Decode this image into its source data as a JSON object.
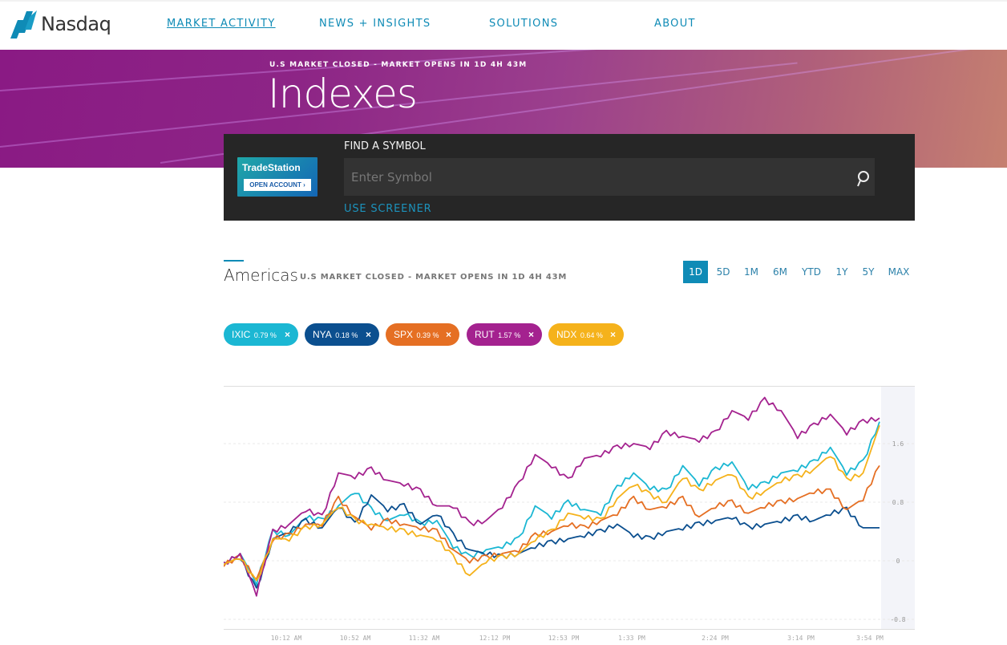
{
  "nav": {
    "logo_text": "Nasdaq",
    "items": [
      {
        "label": "MARKET ACTIVITY",
        "active": true
      },
      {
        "label": "NEWS + INSIGHTS"
      },
      {
        "label": "SOLUTIONS"
      },
      {
        "label": "ABOUT"
      }
    ]
  },
  "hero": {
    "status": "U.S MARKET CLOSED - MARKET OPENS IN 1D 4H 43M",
    "title": "Indexes"
  },
  "find": {
    "ad_brand": "TradeStation",
    "ad_button": "OPEN ACCOUNT ›",
    "label": "FIND A SYMBOL",
    "placeholder": "Enter Symbol",
    "screener": "USE SCREENER",
    "search_icon": "search-icon"
  },
  "region": {
    "title": "Americas",
    "status": "U.S MARKET CLOSED - MARKET OPENS IN 1D 4H 43M"
  },
  "timeframes": [
    "1D",
    "5D",
    "1M",
    "6M",
    "YTD",
    "1Y",
    "5Y",
    "MAX"
  ],
  "active_timeframe": "1D",
  "chips": [
    {
      "symbol": "IXIC",
      "pct": "0.79 %",
      "color": "#1bb7d3"
    },
    {
      "symbol": "NYA",
      "pct": "0.18 %",
      "color": "#0b4f8f"
    },
    {
      "symbol": "SPX",
      "pct": "0.39 %",
      "color": "#e56f23"
    },
    {
      "symbol": "RUT",
      "pct": "1.57 %",
      "color": "#a4228f"
    },
    {
      "symbol": "NDX",
      "pct": "0.64 %",
      "color": "#f5b21b"
    }
  ],
  "chart_data": {
    "type": "line",
    "title": "",
    "xlabel": "",
    "ylabel": "",
    "ylim": [
      -0.8,
      2.4
    ],
    "yticks": [
      "1.6",
      "0.8",
      "0",
      "-0.8"
    ],
    "ytick_values": [
      1.6,
      0.8,
      0,
      -0.8
    ],
    "xtick_labels": [
      "10:12 AM",
      "10:52 AM",
      "11:32 AM",
      "12:12 PM",
      "12:53 PM",
      "1:33 PM",
      "2:24 PM",
      "3:14 PM",
      "3:54 PM"
    ],
    "grid": true,
    "series": [
      {
        "name": "IXIC",
        "color": "#1bb7d3",
        "values": [
          -0.05,
          0.1,
          -0.3,
          0.4,
          0.35,
          0.6,
          0.55,
          0.75,
          0.95,
          0.7,
          0.55,
          0.65,
          0.5,
          0.55,
          0.2,
          0.05,
          0.15,
          0.2,
          0.3,
          0.75,
          0.6,
          0.8,
          0.7,
          0.65,
          1.0,
          1.2,
          1.0,
          0.95,
          1.3,
          1.05,
          1.25,
          1.35,
          1.0,
          1.05,
          1.2,
          1.25,
          1.35,
          1.55,
          1.2,
          1.35,
          1.9
        ]
      },
      {
        "name": "NYA",
        "color": "#0b4f8f",
        "values": [
          -0.05,
          0.05,
          -0.4,
          0.3,
          0.4,
          0.55,
          0.45,
          0.75,
          0.5,
          0.9,
          0.7,
          0.75,
          0.5,
          0.65,
          0.35,
          0.15,
          0.1,
          0.05,
          0.1,
          0.2,
          0.25,
          0.3,
          0.35,
          0.4,
          0.5,
          0.35,
          0.3,
          0.4,
          0.45,
          0.5,
          0.55,
          0.6,
          0.45,
          0.5,
          0.55,
          0.6,
          0.55,
          0.65,
          0.7,
          0.45,
          0.45
        ]
      },
      {
        "name": "SPX",
        "color": "#e56f23",
        "values": [
          -0.05,
          0.05,
          -0.25,
          0.3,
          0.35,
          0.5,
          0.5,
          0.85,
          0.6,
          0.45,
          0.55,
          0.5,
          0.45,
          0.4,
          0.15,
          0.0,
          0.05,
          0.1,
          0.15,
          0.35,
          0.4,
          0.5,
          0.45,
          0.55,
          0.65,
          0.85,
          0.7,
          0.75,
          0.85,
          0.6,
          0.75,
          0.8,
          0.65,
          0.75,
          0.8,
          0.85,
          0.95,
          0.95,
          0.7,
          0.85,
          1.3
        ]
      },
      {
        "name": "RUT",
        "color": "#a4228f",
        "values": [
          -0.05,
          0.1,
          -0.45,
          0.4,
          0.5,
          0.7,
          0.6,
          1.2,
          1.15,
          1.25,
          1.1,
          1.05,
          0.95,
          0.75,
          0.75,
          0.5,
          0.55,
          0.75,
          1.05,
          1.45,
          1.3,
          1.1,
          1.4,
          1.45,
          1.55,
          1.6,
          1.55,
          1.75,
          1.7,
          1.65,
          1.75,
          2.05,
          1.95,
          2.2,
          2.05,
          1.7,
          1.85,
          2.0,
          1.75,
          1.9,
          1.95
        ]
      },
      {
        "name": "NDX",
        "color": "#f5b21b",
        "values": [
          -0.05,
          0.05,
          -0.3,
          0.3,
          0.3,
          0.45,
          0.5,
          0.75,
          0.55,
          0.5,
          0.45,
          0.4,
          0.35,
          0.3,
          0.05,
          -0.2,
          0.0,
          0.05,
          0.1,
          0.3,
          0.4,
          0.65,
          0.6,
          0.55,
          0.85,
          1.05,
          0.9,
          0.8,
          1.15,
          0.95,
          1.1,
          1.2,
          0.85,
          0.95,
          1.1,
          1.15,
          1.25,
          1.45,
          1.1,
          1.2,
          1.85
        ]
      }
    ]
  }
}
